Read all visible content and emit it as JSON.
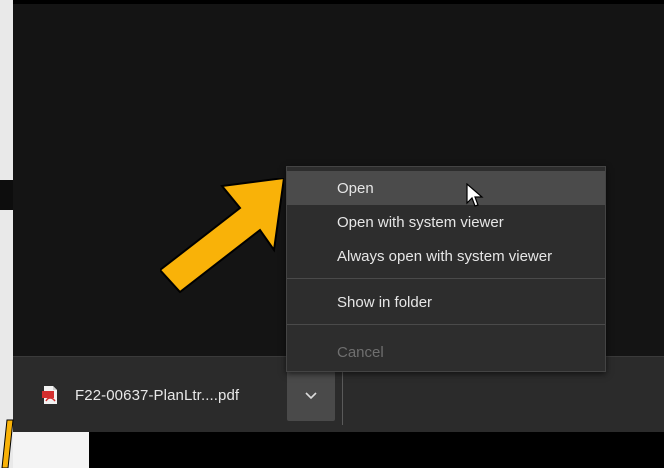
{
  "download_bar": {
    "filename": "F22-00637-PlanLtr....pdf",
    "file_icon": "pdf-file-icon",
    "chevron_icon": "chevron-down-icon"
  },
  "context_menu": {
    "items": [
      {
        "label": "Open",
        "state": "hover"
      },
      {
        "label": "Open with system viewer",
        "state": "normal"
      },
      {
        "label": "Always open with system viewer",
        "state": "normal"
      },
      {
        "label": "Show in folder",
        "state": "normal"
      },
      {
        "label": "Cancel",
        "state": "disabled"
      }
    ]
  },
  "annotation": {
    "arrow_color": "#f9b208",
    "arrow_icon": "arrow-pointing-up-right-icon"
  },
  "colors": {
    "menu_bg": "#2d2d2d",
    "menu_hover": "#4b4b4b",
    "bar_bg": "#2b2b2b",
    "button_bg": "#4a4a4a"
  }
}
